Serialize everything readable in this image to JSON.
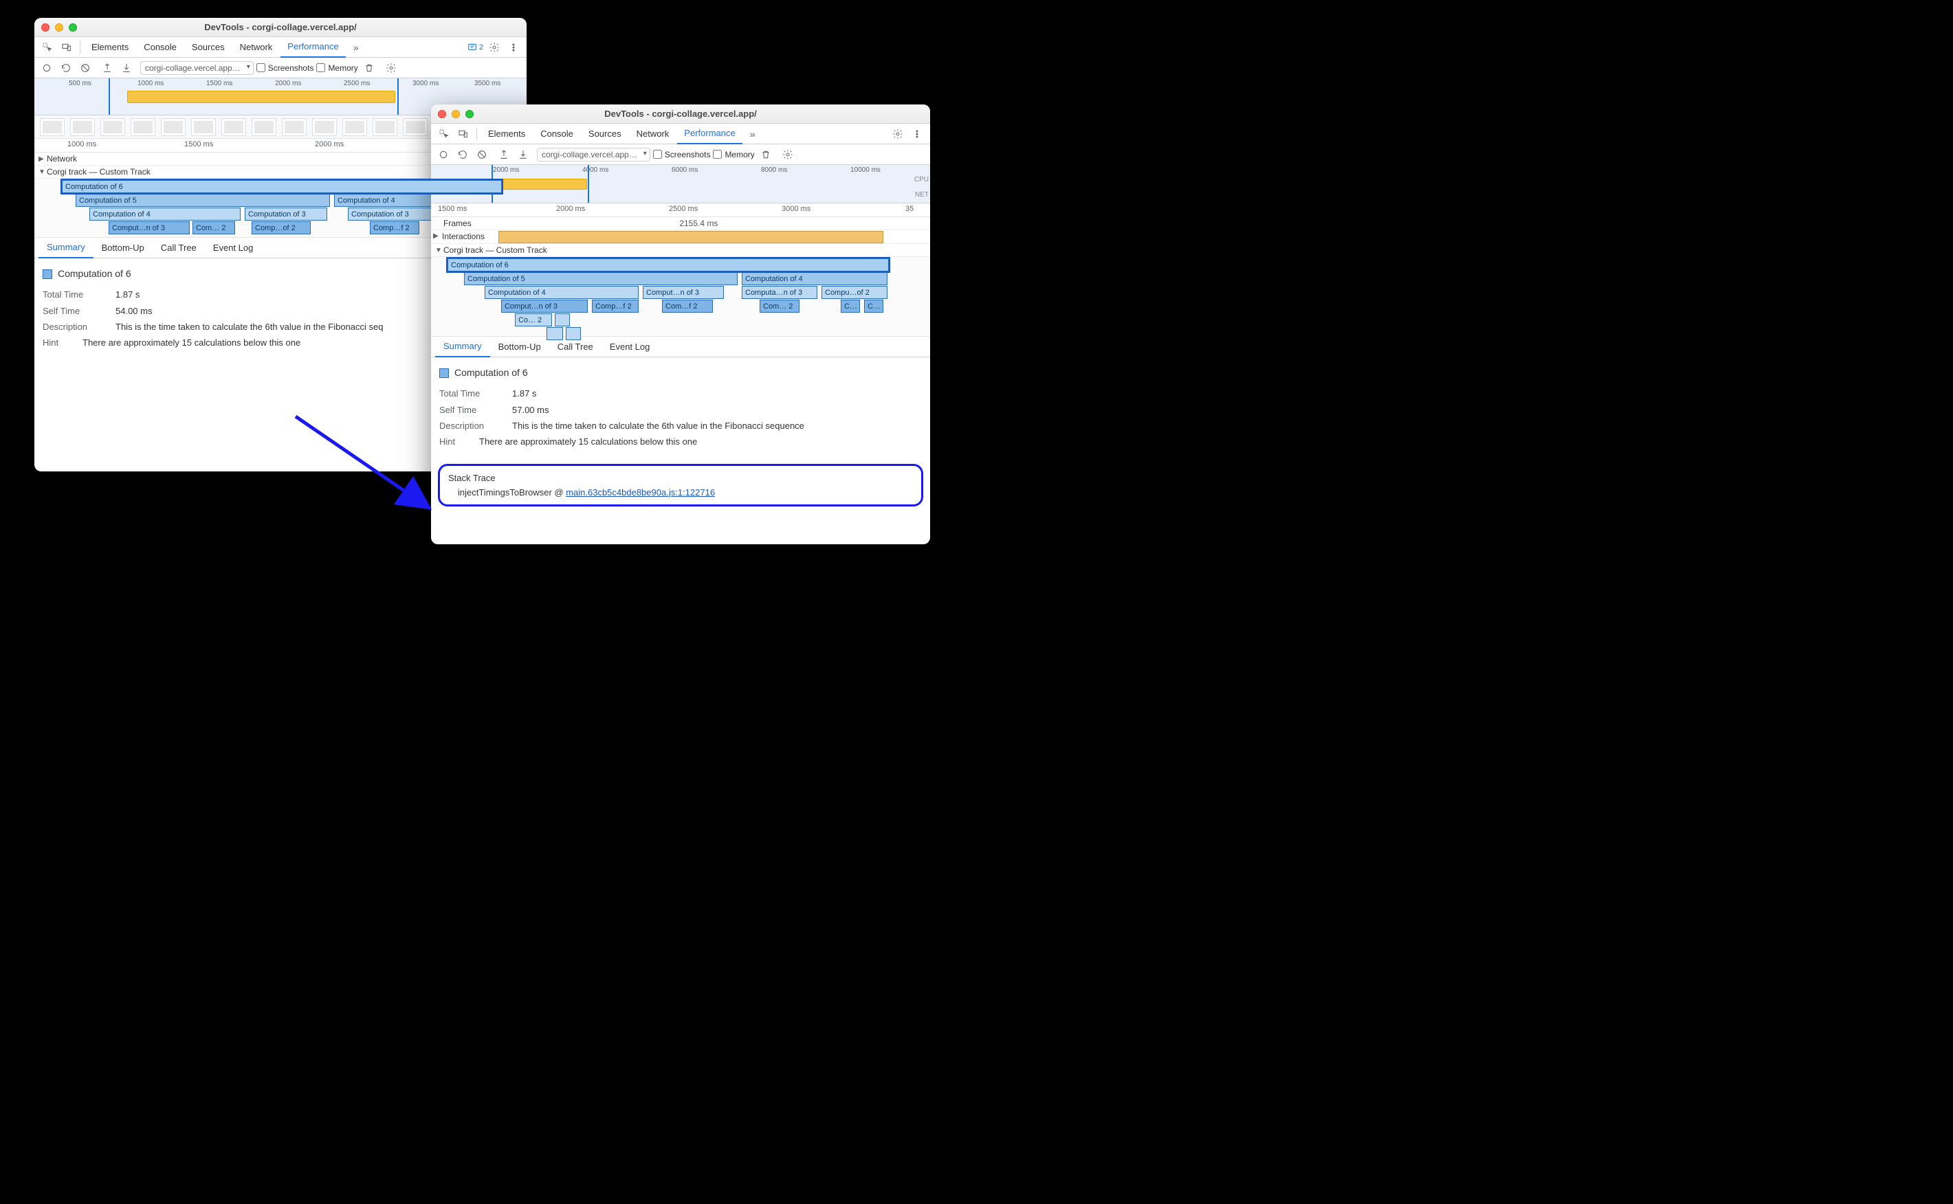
{
  "windowA": {
    "title": "DevTools - corgi-collage.vercel.app/",
    "url": "corgi-collage.vercel.app…",
    "tabs": {
      "elements": "Elements",
      "console": "Console",
      "sources": "Sources",
      "network": "Network",
      "performance": "Performance",
      "more": "»"
    },
    "issuesCount": "2",
    "toolbar": {
      "screenshots": "Screenshots",
      "memory": "Memory"
    },
    "miniTicks": [
      "500 ms",
      "1000 ms",
      "1500 ms",
      "2000 ms",
      "2500 ms",
      "3000 ms",
      "3500 ms"
    ],
    "rulerTicks": [
      "1000 ms",
      "1500 ms",
      "2000 ms"
    ],
    "tracks": {
      "network": "Network",
      "custom": "Corgi track — Custom Track"
    },
    "flame": {
      "l0": "Computation of 6",
      "l1a": "Computation of 5",
      "l1b": "Computation of 4",
      "l2a": "Computation of 4",
      "l2b": "Computation of 3",
      "l2c": "Computation of 3",
      "l3a": "Comput…n of 3",
      "l3b": "Com… 2",
      "l3c": "Comp…of 2",
      "l3d": "Comp…f 2"
    },
    "sumTabs": {
      "summary": "Summary",
      "bottomup": "Bottom-Up",
      "calltree": "Call Tree",
      "eventlog": "Event Log"
    },
    "summary": {
      "title": "Computation of 6",
      "totalLbl": "Total Time",
      "totalVal": "1.87 s",
      "selfLbl": "Self Time",
      "selfVal": "54.00 ms",
      "descLbl": "Description",
      "descVal": "This is the time taken to calculate the 6th value in the Fibonacci seq",
      "hintLbl": "Hint",
      "hintVal": "There are approximately 15 calculations below this one"
    }
  },
  "windowB": {
    "title": "DevTools - corgi-collage.vercel.app/",
    "url": "corgi-collage.vercel.app…",
    "tabs": {
      "elements": "Elements",
      "console": "Console",
      "sources": "Sources",
      "network": "Network",
      "performance": "Performance",
      "more": "»"
    },
    "toolbar": {
      "screenshots": "Screenshots",
      "memory": "Memory"
    },
    "miniTicks": [
      "2000 ms",
      "4000 ms",
      "6000 ms",
      "8000 ms",
      "10000 ms"
    ],
    "sideLabels": {
      "cpu": "CPU",
      "net": "NET"
    },
    "rulerTicks": [
      "1500 ms",
      "2000 ms",
      "2500 ms",
      "3000 ms",
      "35"
    ],
    "frames": "Frames",
    "framesVal": "2155.4 ms",
    "interactions": "Interactions",
    "customTrack": "Corgi track — Custom Track",
    "flame": {
      "l0": "Computation of 6",
      "l1a": "Computation of 5",
      "l1b": "Computation of 4",
      "l2a": "Computation of 4",
      "l2b": "Comput…n of 3",
      "l2c": "Computa…n of 3",
      "l2d": "Compu…of 2",
      "l3a": "Comput…n of 3",
      "l3b": "Comp…f 2",
      "l3c": "Com…f 2",
      "l3d": "Com… 2",
      "l3e": "C…",
      "l3f": "C…",
      "l4a": "Co… 2",
      "l4b": "",
      "l4c": "",
      "l4d": ""
    },
    "sumTabs": {
      "summary": "Summary",
      "bottomup": "Bottom-Up",
      "calltree": "Call Tree",
      "eventlog": "Event Log"
    },
    "summary": {
      "title": "Computation of 6",
      "totalLbl": "Total Time",
      "totalVal": "1.87 s",
      "selfLbl": "Self Time",
      "selfVal": "57.00 ms",
      "descLbl": "Description",
      "descVal": "This is the time taken to calculate the 6th value in the Fibonacci sequence",
      "hintLbl": "Hint",
      "hintVal": "There are approximately 15 calculations below this one"
    },
    "stack": {
      "title": "Stack Trace",
      "fn": "injectTimingsToBrowser @ ",
      "link": "main.63cb5c4bde8be90a.js:1:122716"
    }
  }
}
